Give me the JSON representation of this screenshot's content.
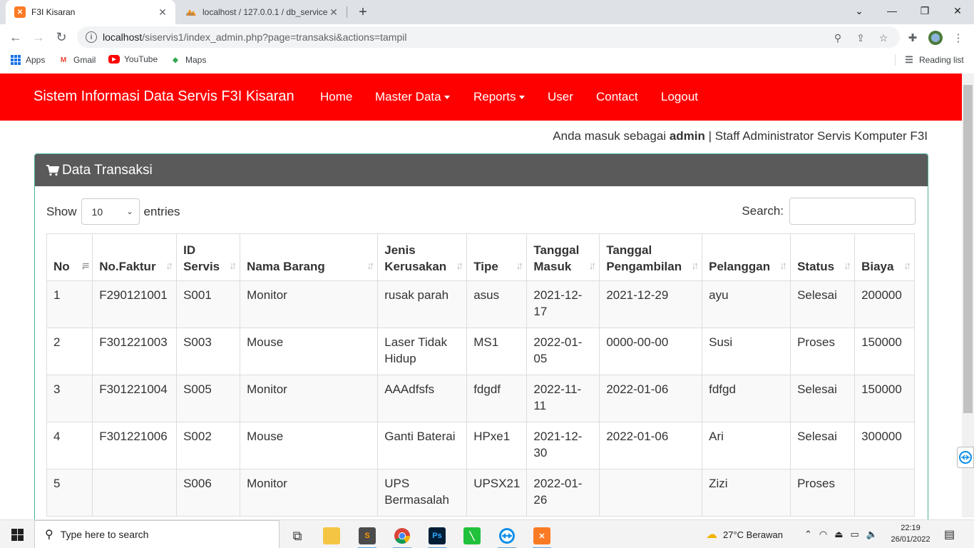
{
  "browser": {
    "tabs": [
      {
        "title": "F3I Kisaran"
      },
      {
        "title": "localhost / 127.0.0.1 / db_service"
      }
    ],
    "url_host": "localhost",
    "url_path": "/siservis1/index_admin.php?page=transaksi&actions=tampil",
    "bookmarks": [
      "Apps",
      "Gmail",
      "YouTube",
      "Maps"
    ],
    "reading_list": "Reading list"
  },
  "navbar": {
    "brand": "Sistem Informasi Data Servis F3I Kisaran",
    "links": [
      "Home",
      "Master Data",
      "Reports",
      "User",
      "Contact",
      "Logout"
    ],
    "color": "#ff0000"
  },
  "login": {
    "prefix": "Anda masuk sebagai",
    "user": "admin",
    "suffix": "| Staff Administrator Servis Komputer F3I"
  },
  "panel": {
    "title": "Data Transaksi",
    "show_label": "Show",
    "entries_value": "10",
    "entries_label": "entries",
    "search_label": "Search:"
  },
  "table": {
    "columns": [
      [
        "No",
        ""
      ],
      [
        "No.Faktur",
        ""
      ],
      [
        "ID",
        "Servis"
      ],
      [
        "Nama Barang",
        ""
      ],
      [
        "Jenis",
        "Kerusakan"
      ],
      [
        "Tipe",
        ""
      ],
      [
        "Tanggal",
        "Masuk"
      ],
      [
        "Tanggal",
        "Pengambilan"
      ],
      [
        "Pelanggan",
        ""
      ],
      [
        "Status",
        ""
      ],
      [
        "Biaya",
        ""
      ]
    ],
    "rows": [
      [
        "1",
        "F290121001",
        "S001",
        "Monitor",
        "rusak parah",
        "asus",
        "2021-12-17",
        "2021-12-29",
        "ayu",
        "Selesai",
        "200000"
      ],
      [
        "2",
        "F301221003",
        "S003",
        "Mouse",
        "Laser Tidak Hidup",
        "MS1",
        "2022-01-05",
        "0000-00-00",
        "Susi",
        "Proses",
        "150000"
      ],
      [
        "3",
        "F301221004",
        "S005",
        "Monitor",
        "AAAdfsfs",
        "fdgdf",
        "2022-11-11",
        "2022-01-06",
        "fdfgd",
        "Selesai",
        "150000"
      ],
      [
        "4",
        "F301221006",
        "S002",
        "Mouse",
        "Ganti Baterai",
        "HPxe1",
        "2021-12-30",
        "2022-01-06",
        "Ari",
        "Selesai",
        "300000"
      ],
      [
        "5",
        "",
        "S006",
        "Monitor",
        "UPS Bermasalah",
        "UPSX21",
        "2022-01-26",
        "",
        "Zizi",
        "Proses",
        ""
      ]
    ]
  },
  "taskbar": {
    "search_placeholder": "Type here to search",
    "weather": "27°C  Berawan",
    "time": "22:19",
    "date": "26/01/2022"
  }
}
